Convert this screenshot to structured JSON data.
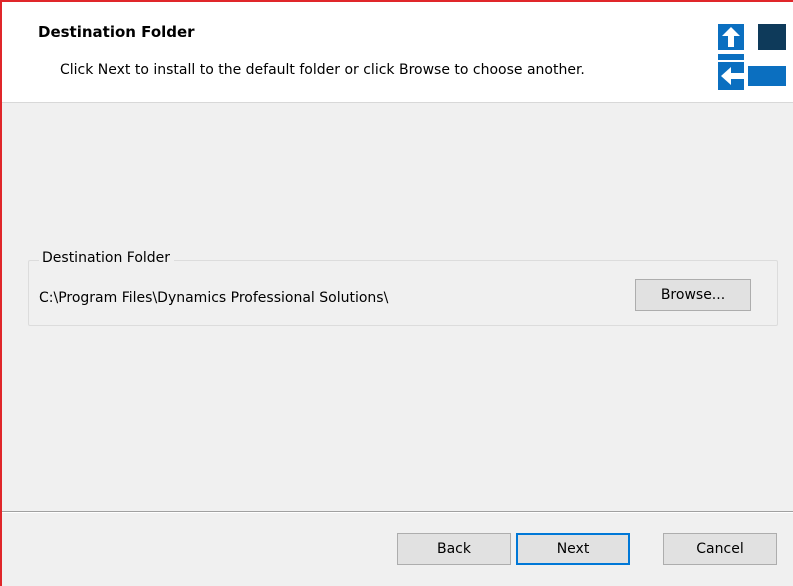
{
  "header": {
    "title": "Destination Folder",
    "subtitle": "Click Next to install to the default folder or click Browse to choose another."
  },
  "destination_group": {
    "legend": "Destination Folder",
    "path": "C:\\Program Files\\Dynamics Professional Solutions\\",
    "browse_label": "Browse..."
  },
  "footer": {
    "back_label": "Back",
    "next_label": "Next",
    "cancel_label": "Cancel"
  },
  "colors": {
    "window_border": "#e0262a",
    "logo_primary": "#0b6fc0",
    "logo_dark": "#0e3a5a",
    "focus_accent": "#0078d7"
  },
  "icons": {
    "logo": "installer-logo-icon"
  }
}
